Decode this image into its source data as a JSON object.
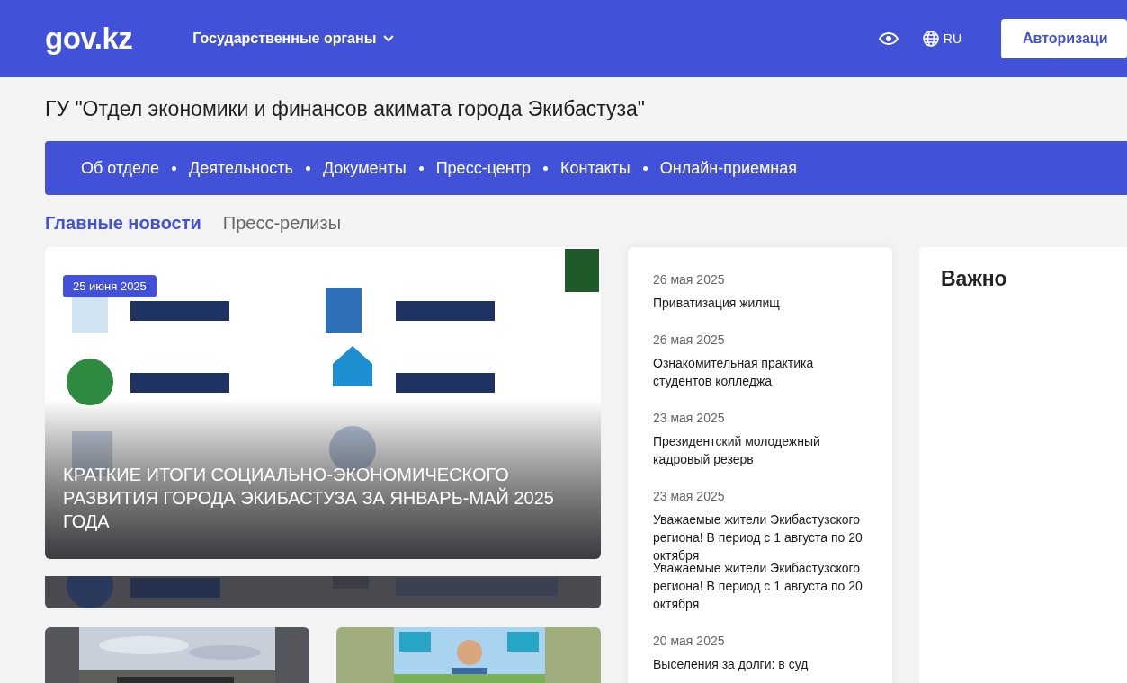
{
  "header": {
    "logo": "gov.kz",
    "agencies_menu": "Государственные органы",
    "language": "RU",
    "login_button": "Авторизаци"
  },
  "page_title": "ГУ \"Отдел экономики и финансов акимата города Экибастуза\"",
  "nav": [
    "Об отделе",
    "Деятельность",
    "Документы",
    "Пресс-центр",
    "Контакты",
    "Онлайн-приемная"
  ],
  "news_tabs": [
    {
      "label": "Главные новости",
      "selected": true
    },
    {
      "label": "Пресс-релизы",
      "selected": false
    }
  ],
  "featured": {
    "date": "25 июня 2025",
    "title": "КРАТКИЕ ИТОГИ СОЦИАЛЬНО-ЭКОНОМИЧЕСКОГО РАЗВИТИЯ ГОРОДА ЭКИБАСТУЗА ЗА ЯНВАРЬ-МАЙ 2025 ГОДА"
  },
  "news_list": [
    {
      "date": "26 мая 2025",
      "title": "Приватизация жилищ"
    },
    {
      "date": "26 мая 2025",
      "title": "Ознакомительная практика студентов колледжа"
    },
    {
      "date": "23 мая 2025",
      "title": "Президентский молодежный кадровый резерв"
    },
    {
      "date": "23 мая 2025",
      "title": "Уважаемые жители Экибастузского региона! В период с 1 августа по 20 октября",
      "repeat": "Уважаемые жители Экибастузского региона! В период с 1 августа по 20 октября"
    },
    {
      "date": "20 мая 2025",
      "title": "Выселения за долги: в суд"
    }
  ],
  "important": {
    "title": "Важно"
  }
}
